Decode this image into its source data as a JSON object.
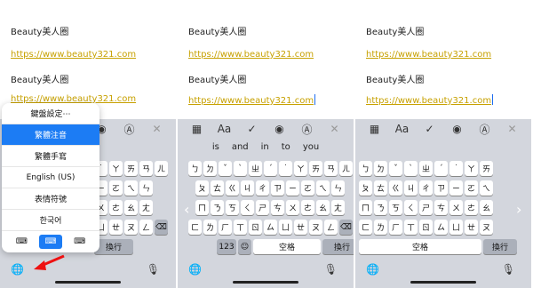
{
  "panels": [
    {
      "title": "Beauty美人圈",
      "url1": "https://www.beauty321.com",
      "title2": "Beauty美人圈",
      "url2": "https://www.beauty321.com"
    },
    {
      "title": "Beauty美人圈",
      "url1": "https://www.beauty321.com",
      "title2": "Beauty美人圈",
      "url2": "https://www.beauty321.com"
    },
    {
      "title": "Beauty美人圈",
      "url1": "https://www.beauty321.com",
      "title2": "Beauty美人圈",
      "url2": "https://www.beauty321.com"
    }
  ],
  "toolbar": {
    "table": "▦",
    "format": "Aa",
    "check": "✓",
    "camera": "◉",
    "markup": "Ⓐ",
    "close": "✕"
  },
  "suggestions": [
    "is",
    "and",
    "in",
    "to",
    "you"
  ],
  "keys": {
    "row1": [
      "ㄅ",
      "ㄉ",
      "ˇ",
      "ˋ",
      "ㄓ",
      "ˊ",
      "˙",
      "ㄚ",
      "ㄞ",
      "ㄢ",
      "ㄦ"
    ],
    "row2": [
      "ㄆ",
      "ㄊ",
      "ㄍ",
      "ㄐ",
      "ㄔ",
      "ㄗ",
      "ㄧ",
      "ㄛ",
      "ㄟ",
      "ㄣ"
    ],
    "row3": [
      "ㄇ",
      "ㄋ",
      "ㄎ",
      "ㄑ",
      "ㄕ",
      "ㄘ",
      "ㄨ",
      "ㄜ",
      "ㄠ",
      "ㄤ"
    ],
    "row4": [
      "ㄈ",
      "ㄌ",
      "ㄏ",
      "ㄒ",
      "ㄖ",
      "ㄙ",
      "ㄩ",
      "ㄝ",
      "ㄡ",
      "ㄥ",
      "⌫"
    ],
    "row5": {
      "num": "123",
      "emoji": "☺",
      "space": "空格",
      "enter": "換行"
    }
  },
  "bottom": {
    "globe": "🌐",
    "mic": "🎙"
  },
  "nav": {
    "left": "‹",
    "right": "›"
  },
  "menu": {
    "items": [
      "鍵盤設定⋯",
      "繁體注音",
      "繁體手寫",
      "English (US)",
      "表情符號",
      "한국어"
    ],
    "selected_index": 1,
    "icons": {
      "left": "⌨",
      "center": "⌨",
      "right": "⌨"
    }
  }
}
